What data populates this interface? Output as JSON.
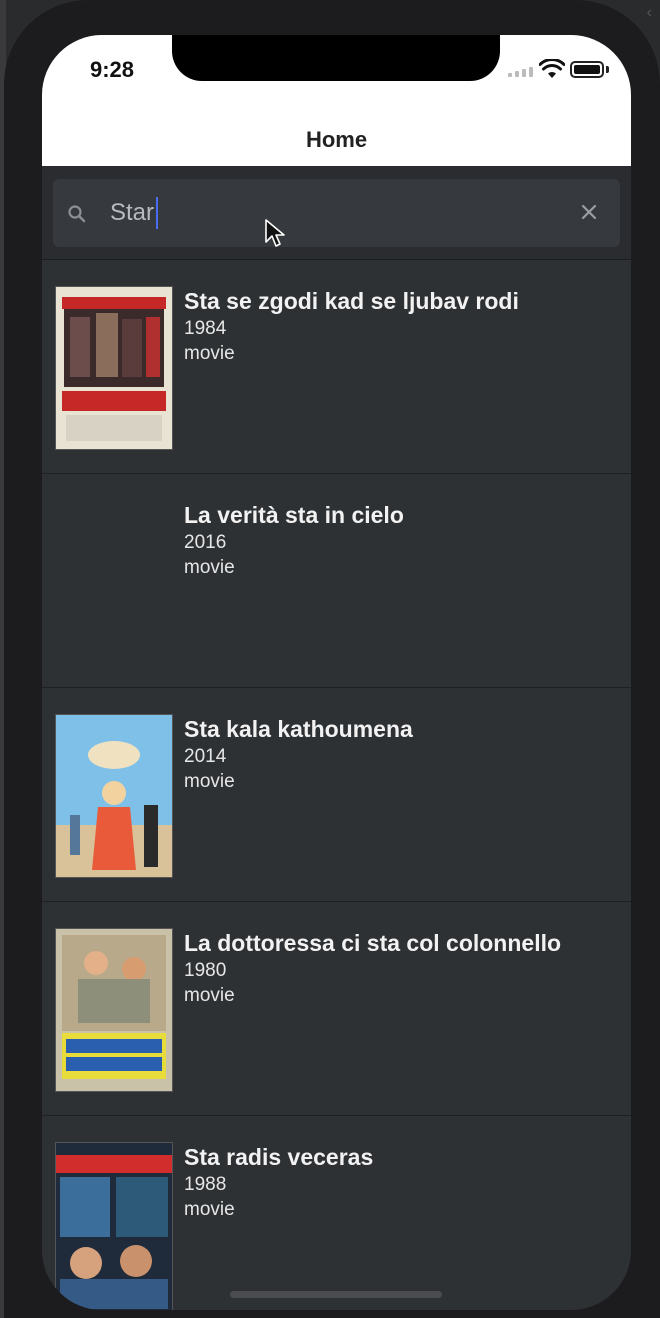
{
  "status": {
    "time": "9:28"
  },
  "nav": {
    "title": "Home"
  },
  "search": {
    "value": "Star",
    "placeholder": ""
  },
  "results": [
    {
      "title": "Sta se zgodi kad se ljubav rodi",
      "year": "1984",
      "type": "movie",
      "poster_label": "Što se zgodi kad se ljubav rodi poster"
    },
    {
      "title": "La verità sta in cielo",
      "year": "2016",
      "type": "movie",
      "poster_label": ""
    },
    {
      "title": "Sta kala kathoumena",
      "year": "2014",
      "type": "movie",
      "poster_label": "Sta kala kathoumena poster"
    },
    {
      "title": "La dottoressa ci sta col colonnello",
      "year": "1980",
      "type": "movie",
      "poster_label": "La dottoressa ci sta col colonnello poster"
    },
    {
      "title": "Sta radis veceras",
      "year": "1988",
      "type": "movie",
      "poster_label": "Šta radiš večeras poster"
    }
  ],
  "colors": {
    "accent_caret": "#4a6cf0",
    "background": "#2e3134",
    "search_box": "#36393d"
  },
  "icons": [
    "search-icon",
    "clear-icon",
    "wifi-icon",
    "battery-icon",
    "cellular-signal-icon",
    "pointer-cursor-icon"
  ]
}
